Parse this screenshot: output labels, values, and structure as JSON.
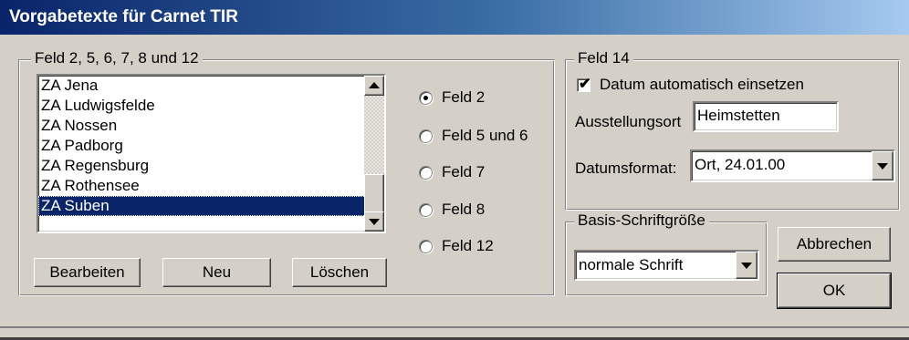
{
  "window": {
    "title": "Vorgabetexte für Carnet TIR"
  },
  "group_fields": {
    "legend": "Feld 2, 5, 6, 7, 8 und 12",
    "list_items": [
      "ZA Jena",
      "ZA Ludwigsfelde",
      "ZA Nossen",
      "ZA Padborg",
      "ZA Regensburg",
      "ZA Rothensee",
      "ZA Suben"
    ],
    "selected_item": "ZA Suben",
    "radio_options": [
      "Feld 2",
      "Feld 5 und 6",
      "Feld 7",
      "Feld 8",
      "Feld 12"
    ],
    "selected_radio": "Feld 2",
    "buttons": {
      "edit": "Bearbeiten",
      "new": "Neu",
      "delete": "Löschen"
    }
  },
  "group_feld14": {
    "legend": "Feld 14",
    "auto_date_label": "Datum automatisch einsetzen",
    "auto_date_checked": true,
    "check_glyph": "✔",
    "place_label": "Ausstellungsort",
    "place_value": "Heimstetten",
    "date_format_label": "Datumsformat:",
    "date_format_value": "Ort, 24.01.00"
  },
  "group_font": {
    "legend": "Basis-Schriftgröße",
    "font_value": "normale Schrift"
  },
  "dialog_buttons": {
    "cancel": "Abbrechen",
    "ok": "OK"
  },
  "icons": {
    "scroll_up": "chevron-up-icon",
    "scroll_down": "chevron-down-icon",
    "dropdown": "chevron-down-icon"
  }
}
